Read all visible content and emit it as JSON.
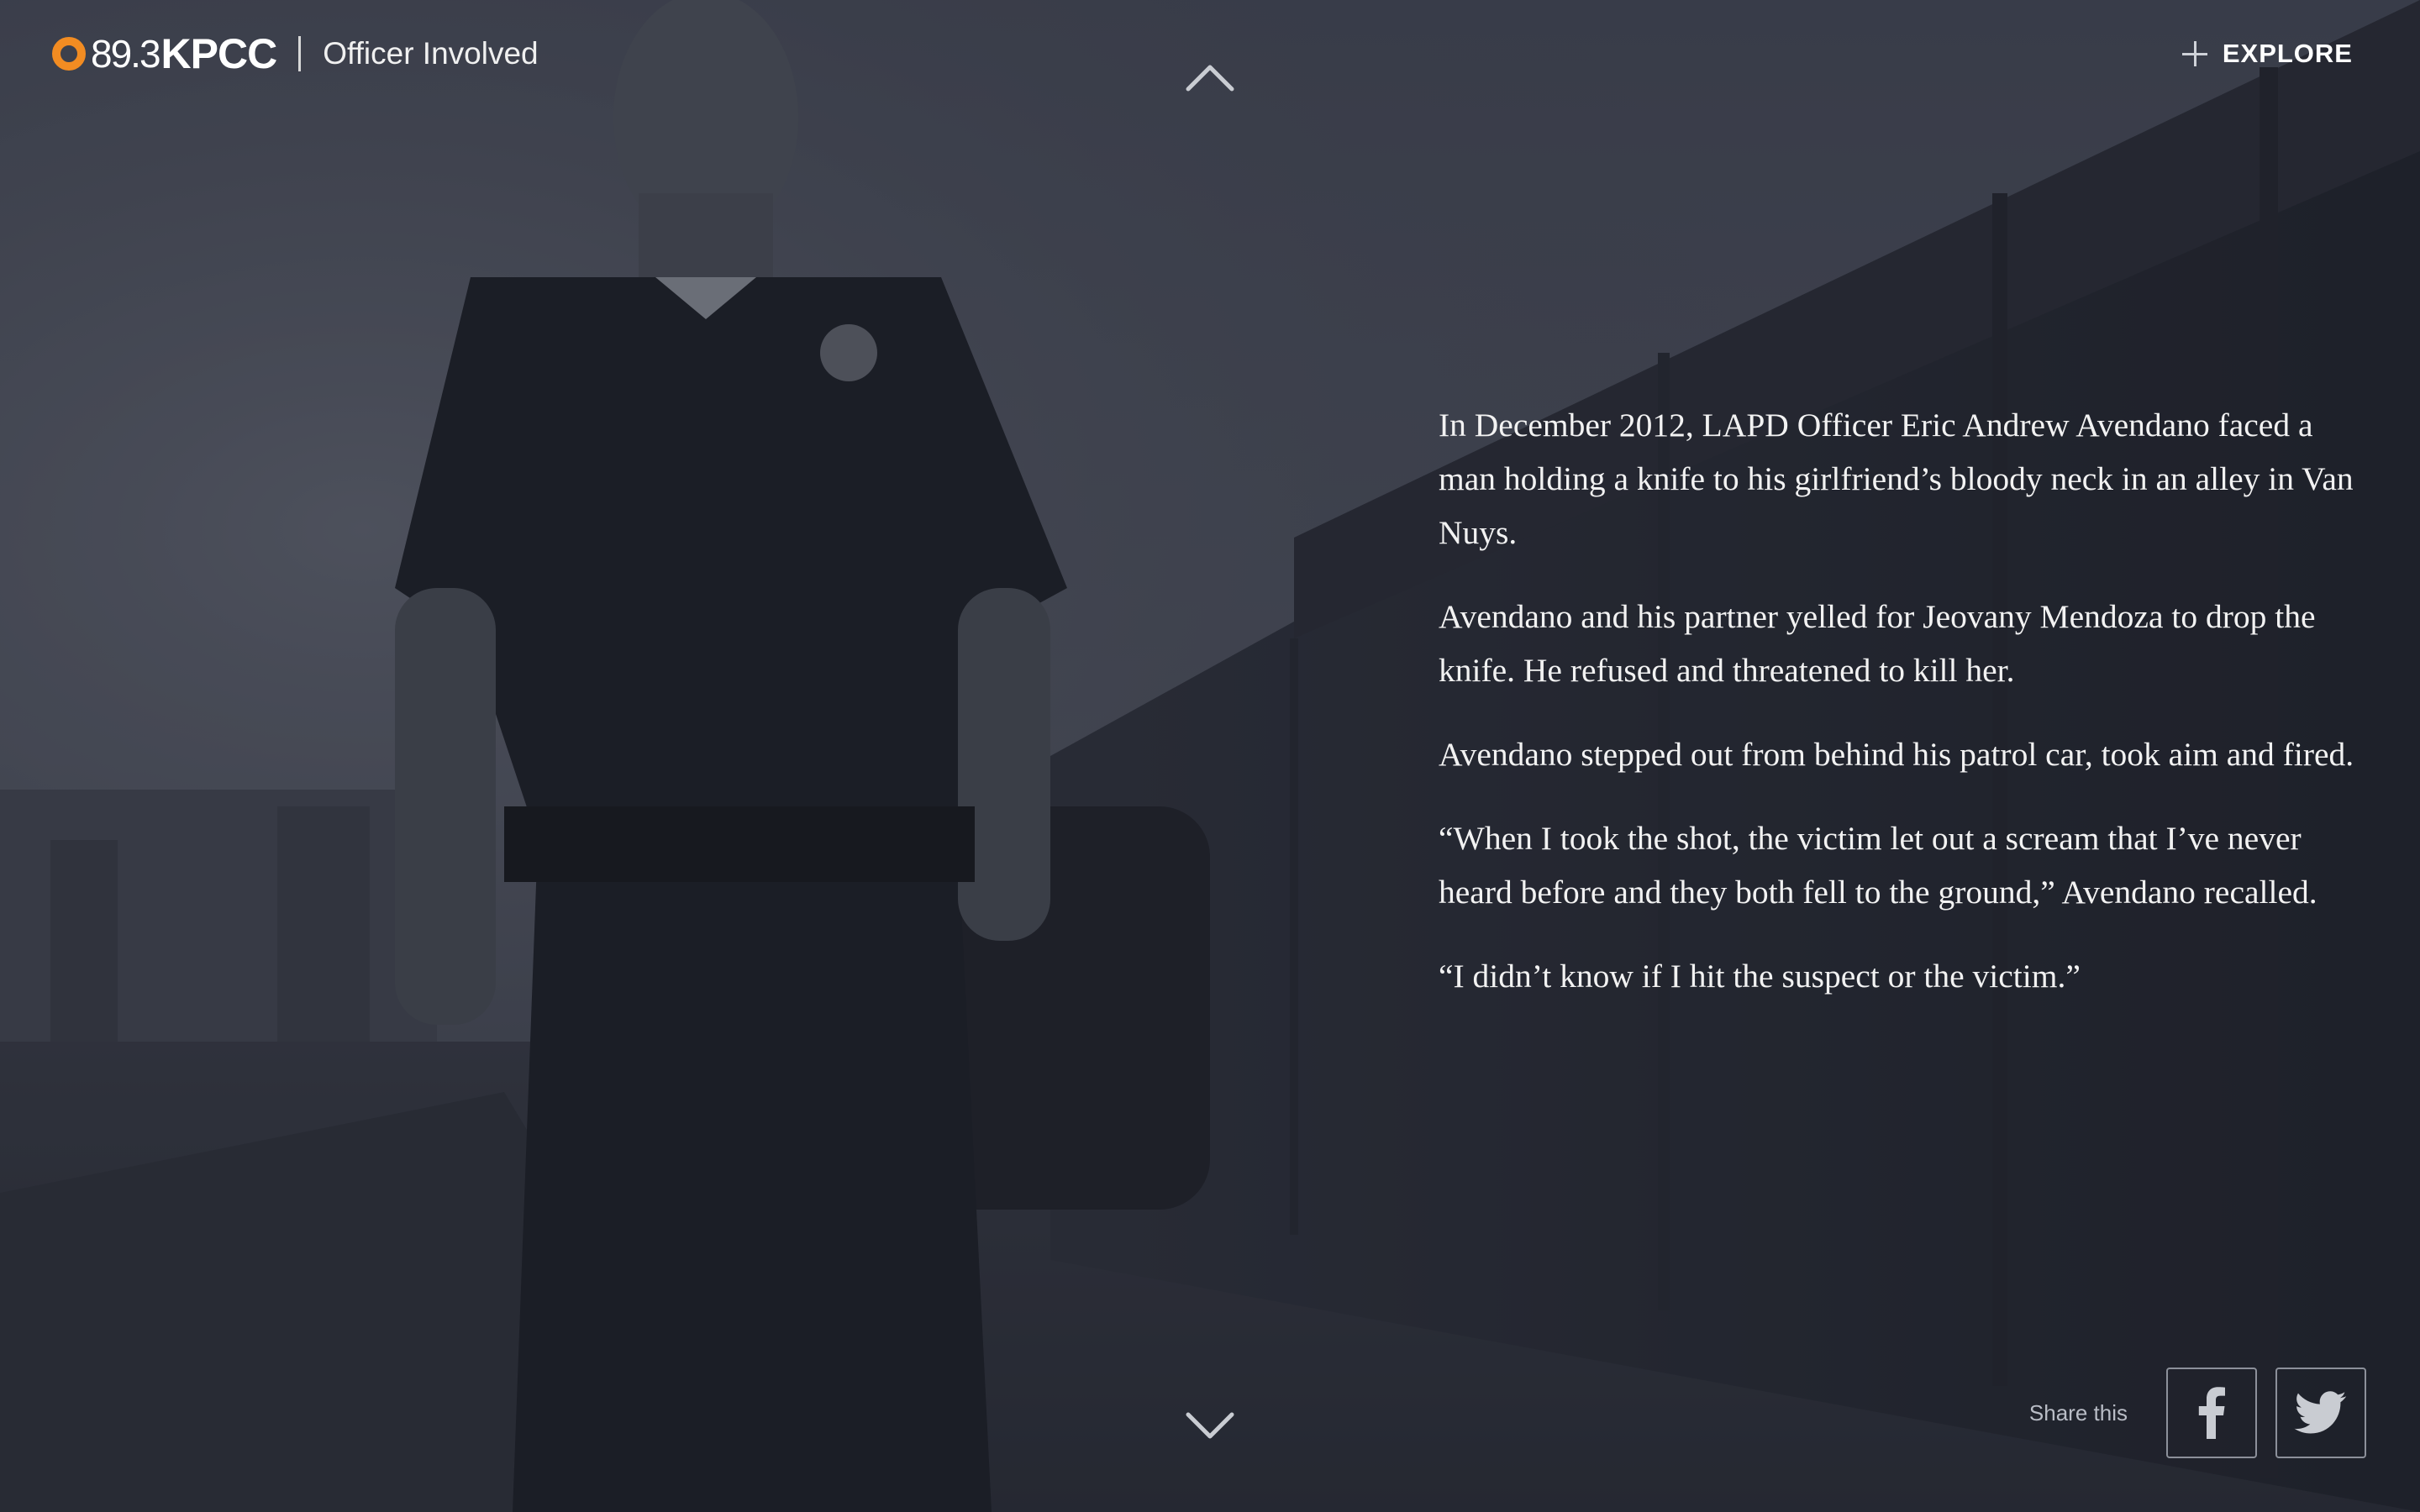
{
  "header": {
    "logo_frequency": "89.3",
    "logo_station": "KPCC",
    "section_title": "Officer Involved",
    "explore_label": "EXPLORE"
  },
  "story": {
    "paragraphs": [
      "In December 2012, LAPD Officer Eric Andrew Avendano faced a man holding a knife to his girlfriend’s bloody neck in an alley in Van Nuys.",
      "Avendano and his partner yelled for Jeovany Mendoza to drop the knife. He refused and threatened to kill her.",
      "Avendano stepped out from behind his patrol car, took aim and fired.",
      "“When I took the shot, the victim let out a scream that I’ve never heard before and they both fell to the ground,” Avendano recalled.",
      "“I didn’t know if I hit the suspect or the victim.”"
    ]
  },
  "share": {
    "label": "Share this",
    "networks": [
      "facebook",
      "twitter"
    ]
  },
  "icons": {
    "prev": "chevron-up-icon",
    "next": "chevron-down-icon",
    "explore": "plus-icon"
  },
  "colors": {
    "brand_orange": "#f28c22",
    "text": "#f2f2f2",
    "overlay": "#1c1f2a"
  }
}
